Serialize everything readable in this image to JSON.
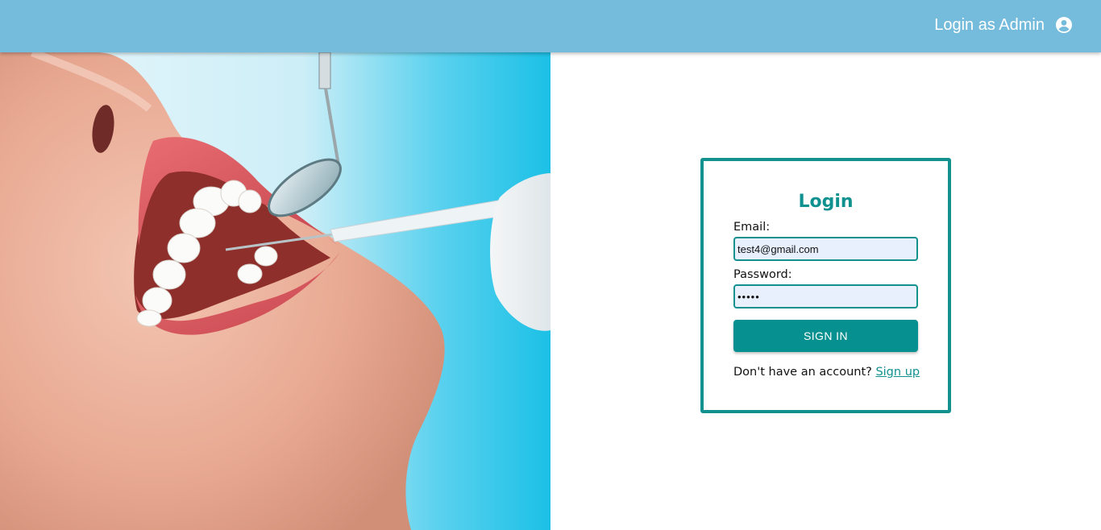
{
  "header": {
    "admin_link_label": "Login as Admin",
    "admin_icon": "account-circle-icon",
    "background_color": "#74bbdc"
  },
  "hero": {
    "image_subject": "dental examination photo",
    "accent_color": "#1cc0e6"
  },
  "login": {
    "title": "Login",
    "email_label": "Email:",
    "email_value": "test4@gmail.com",
    "password_label": "Password:",
    "password_value": "•••••",
    "signin_label": "SIGN IN",
    "signup_prompt": "Don't have an account?",
    "signup_link": "Sign up",
    "accent_color": "#12918f"
  }
}
